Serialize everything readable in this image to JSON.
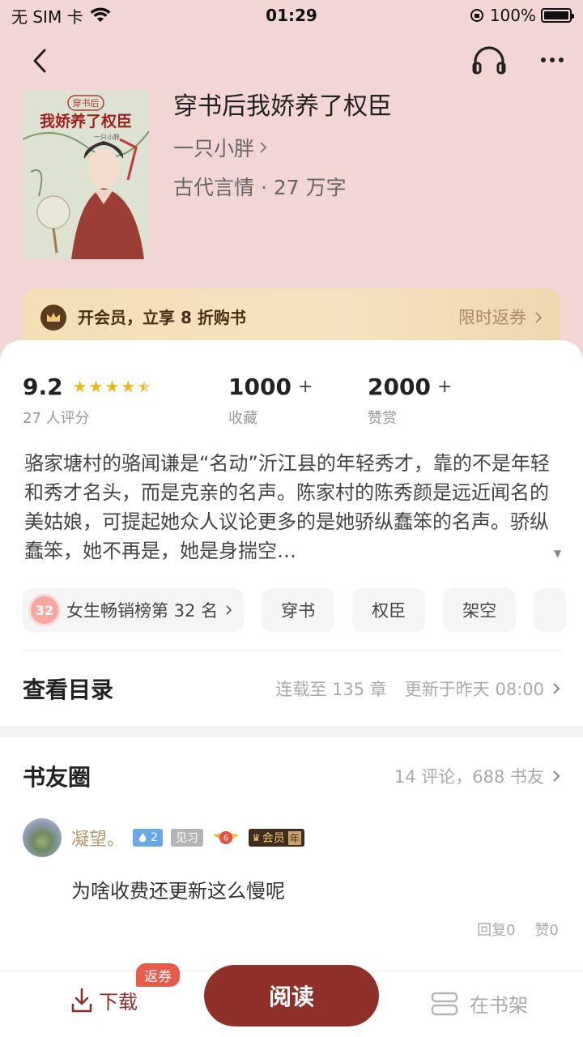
{
  "status": {
    "carrier": "无 SIM 卡",
    "time": "01:29",
    "battery": "100%"
  },
  "book": {
    "title": "穿书后我娇养了权臣",
    "author": "一只小胖",
    "meta": "古代言情 · 27 万字",
    "cover": {
      "tag": "穿书后",
      "title": "我娇养了权臣",
      "author": "一只小胖"
    }
  },
  "vip": {
    "text": "开会员，立享 8 折购书",
    "link": "限时返券"
  },
  "stats": {
    "rating": "9.2",
    "rating_label": "27 人评分",
    "stars": 4.5,
    "collect": "1000",
    "collect_plus": "+",
    "collect_label": "收藏",
    "reward": "2000",
    "reward_plus": "+",
    "reward_label": "赞赏"
  },
  "description": "骆家塘村的骆闻谦是“名动”沂江县的年轻秀才，靠的不是年轻和秀才名头，而是克亲的名声。陈家村的陈秀颜是远近闻名的美姑娘，可提起她众人议论更多的是她骄纵蠢笨的名声。骄纵蠢笨，她不再是，她是身揣空…",
  "tags": {
    "rank_num": "32",
    "rank_label": "女生畅销榜第 32 名",
    "items": [
      "穿书",
      "权臣",
      "架空"
    ]
  },
  "catalog": {
    "title": "查看目录",
    "progress": "连载至 135 章",
    "updated": "更新于昨天 08:00"
  },
  "circle": {
    "title": "书友圈",
    "meta": "14 评论，688 书友",
    "comment": {
      "user": "凝望。",
      "level": "2",
      "rank": "见习",
      "fan_level": "6",
      "vip": "会员",
      "vip_suffix": "年",
      "text": "为啥收费还更新这么慢呢",
      "reply": "回复0",
      "like": "赞0"
    }
  },
  "bottom": {
    "download": "下载",
    "return_badge": "返券",
    "read": "阅读",
    "shelf": "在书架"
  },
  "colors": {
    "background": "#f2d6d6",
    "accent": "#8f2f2a",
    "star": "#f6b21b",
    "vip_text": "#4a2f15"
  }
}
